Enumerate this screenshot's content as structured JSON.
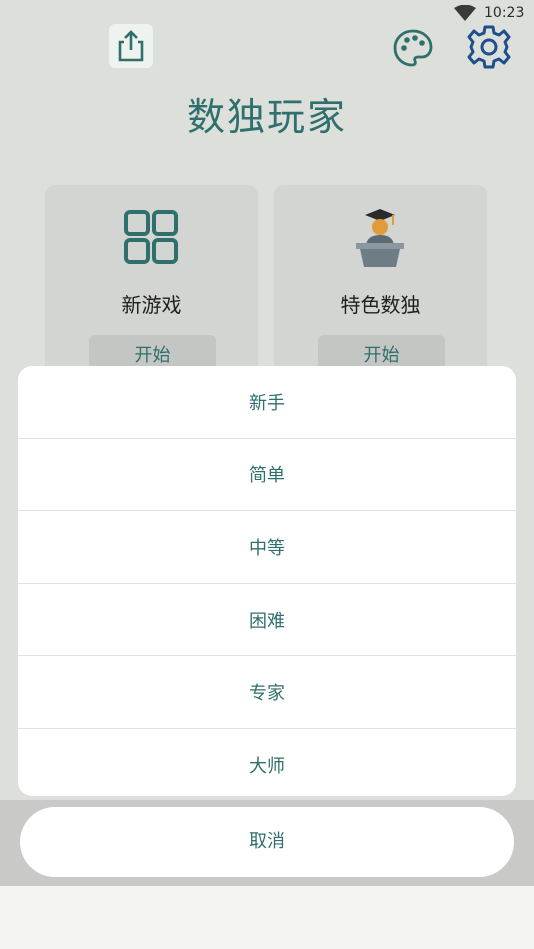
{
  "status_bar": {
    "time": "10:23"
  },
  "header": {
    "title": "数独玩家",
    "share_icon": "share-icon",
    "palette_icon": "palette-icon",
    "settings_icon": "gear-icon"
  },
  "cards": [
    {
      "label": "新游戏",
      "start": "开始",
      "icon": "grid-icon"
    },
    {
      "label": "特色数独",
      "start": "开始",
      "icon": "teacher-podium-icon"
    }
  ],
  "difficulty_sheet": {
    "options": [
      "新手",
      "简单",
      "中等",
      "困难",
      "专家",
      "大师"
    ],
    "cancel": "取消"
  },
  "colors": {
    "accent": "#2f6f6c",
    "background": "#dcdfda",
    "sheet": "#ffffff"
  }
}
